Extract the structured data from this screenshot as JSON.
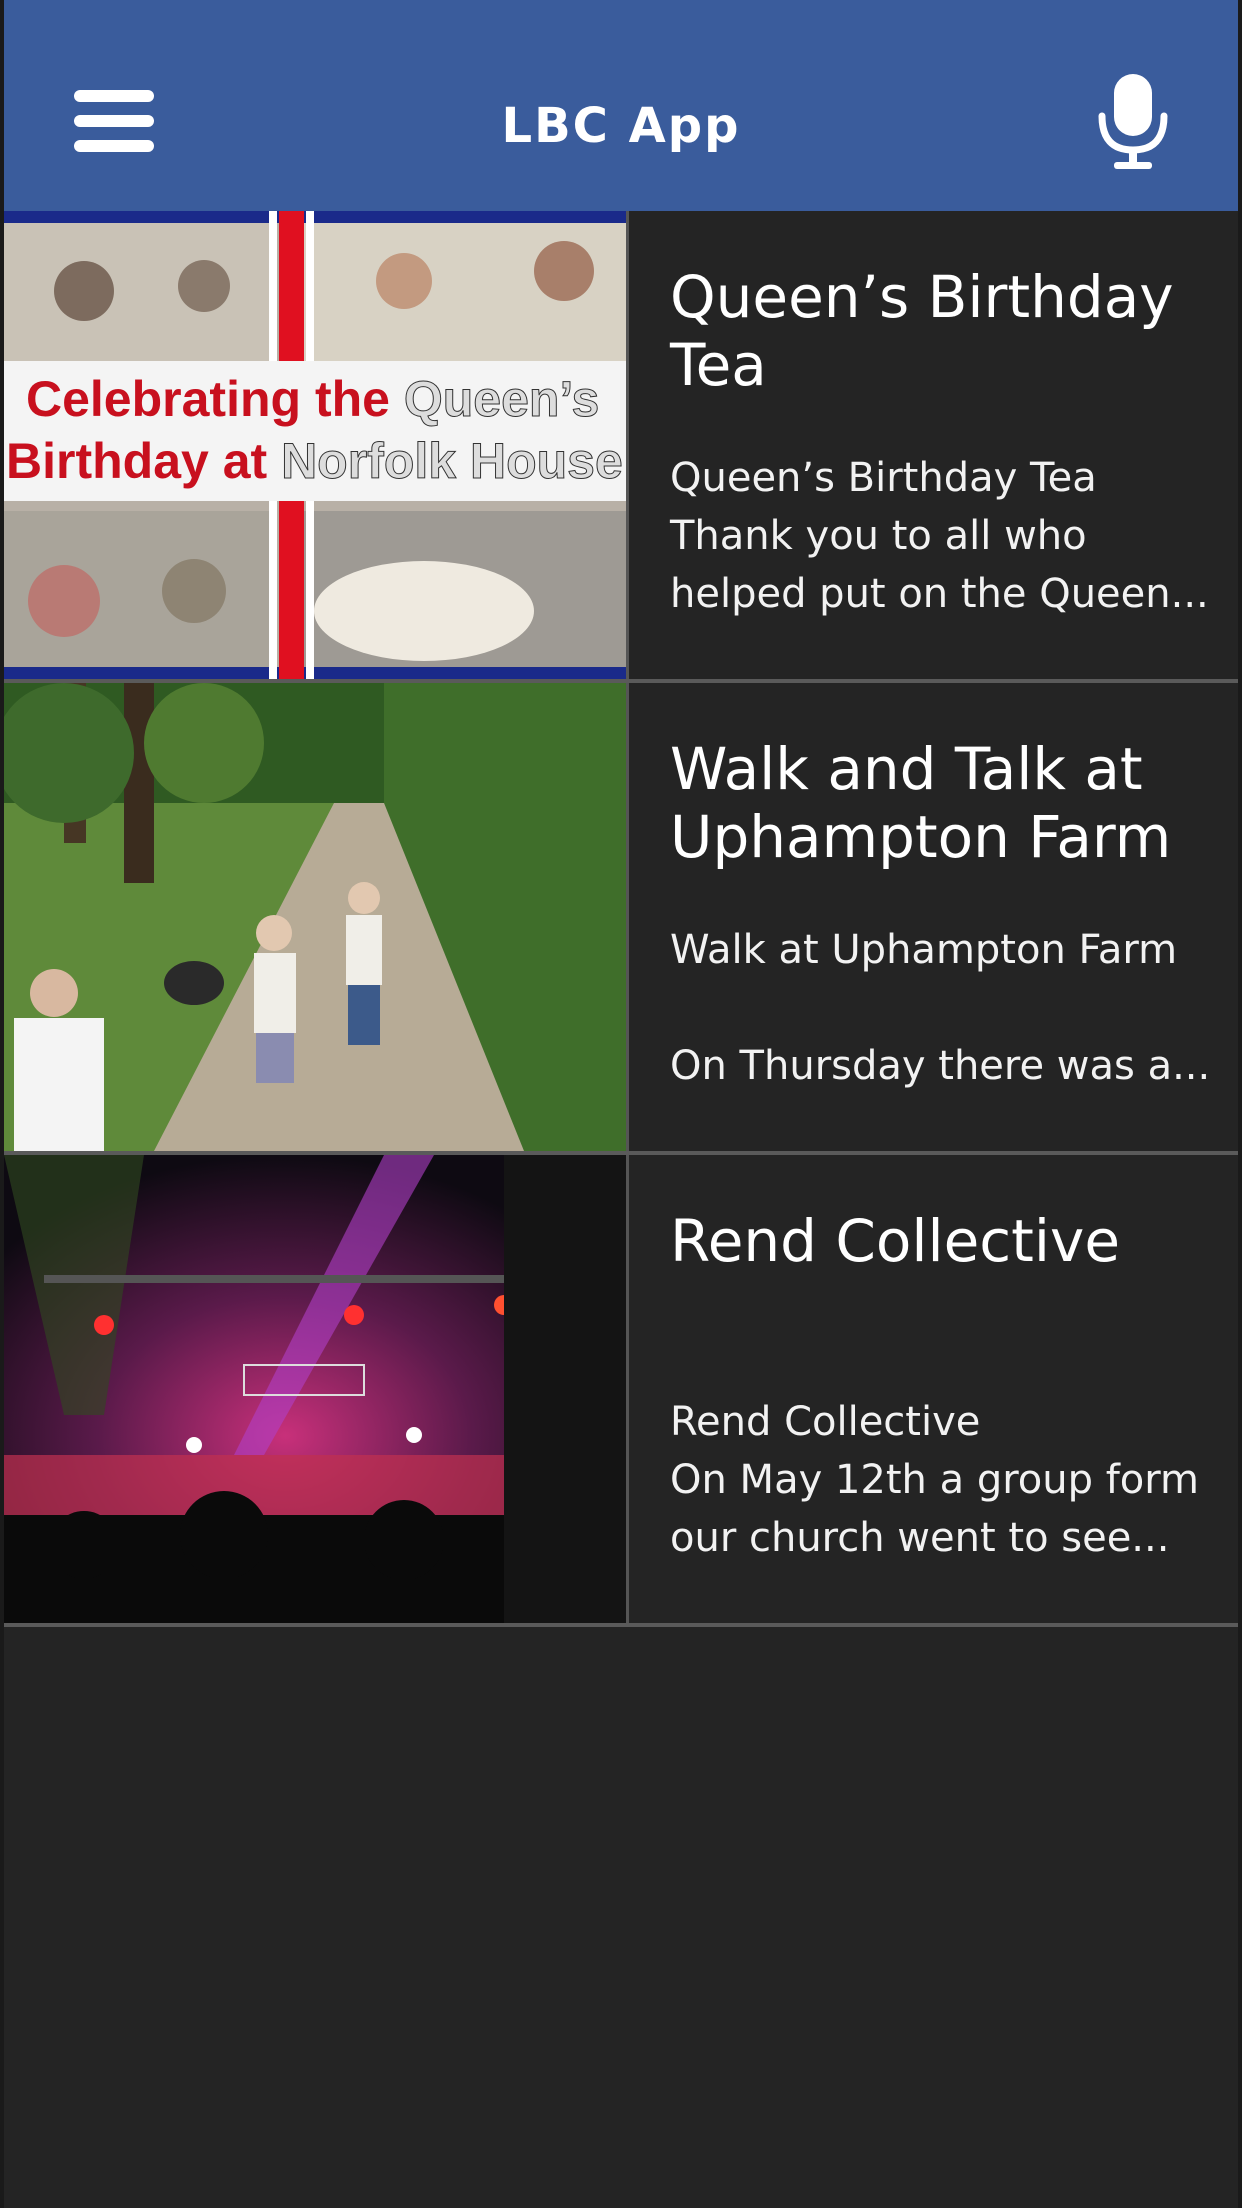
{
  "header": {
    "title": "LBC App",
    "menu_icon": "hamburger-menu-icon",
    "mic_icon": "microphone-icon",
    "background_color": "#3a5c9c"
  },
  "posts": [
    {
      "title": "Queen’s Birthday Tea",
      "excerpt": "Queen’s Birthday Tea\nThank you to all who\nhelped put on the Queen...",
      "image_caption_line1_a": "Celebrating the",
      "image_caption_line1_b": "Queen’s",
      "image_caption_line2_a": "Birthday at",
      "image_caption_line2_b": "Norfolk House"
    },
    {
      "title": "Walk and Talk at Uphampton Farm",
      "excerpt": "Walk at Uphampton Farm\n\nOn Thursday there was a..."
    },
    {
      "title": "Rend Collective",
      "excerpt": "Rend Collective\nOn May 12th a group form\nour church went to see..."
    }
  ]
}
